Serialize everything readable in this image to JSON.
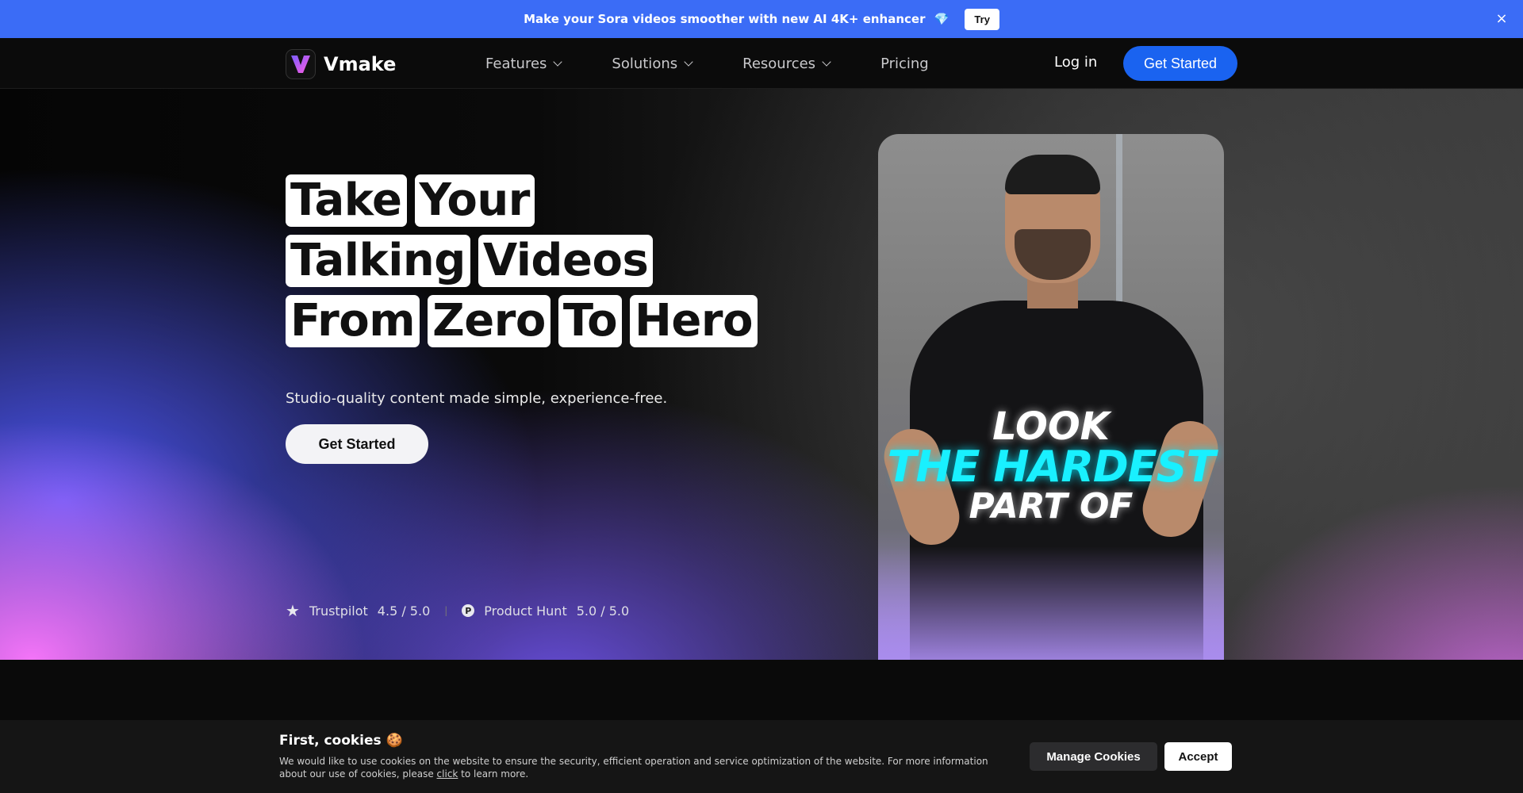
{
  "promo": {
    "text": "Make your Sora videos smoother with new AI 4K+ enhancer",
    "gem": "💎",
    "try_label": "Try",
    "close_icon": "×"
  },
  "nav": {
    "logo_text": "Vmake",
    "items": [
      {
        "label": "Features",
        "has_dropdown": true
      },
      {
        "label": "Solutions",
        "has_dropdown": true
      },
      {
        "label": "Resources",
        "has_dropdown": true
      },
      {
        "label": "Pricing",
        "has_dropdown": false
      }
    ],
    "login_label": "Log in",
    "cta_label": "Get Started"
  },
  "hero": {
    "headline_rows": [
      [
        "Take",
        "Your"
      ],
      [
        "Talking",
        "Videos"
      ],
      [
        "From",
        "Zero",
        "To",
        "Hero"
      ]
    ],
    "subheadline": "Studio-quality content made simple, experience-free.",
    "cta_label": "Get Started",
    "ratings": {
      "trustpilot_label": "Trustpilot",
      "trustpilot_score": "4.5 / 5.0",
      "producthunt_label": "Product Hunt",
      "producthunt_score": "5.0 / 5.0",
      "producthunt_icon_letter": "P",
      "separator": "|"
    }
  },
  "video": {
    "caption_line1": "LOOK",
    "caption_line2": "THE HARDEST",
    "caption_line3": "PART OF"
  },
  "cookie": {
    "title": "First, cookies 🍪",
    "text_before": "We would like to use cookies on the website to ensure the security, efficient operation and service optimization of the website. For more information about our use of cookies, please ",
    "link": "click",
    "text_after": " to learn more.",
    "manage_label": "Manage Cookies",
    "accept_label": "Accept"
  },
  "colors": {
    "promo_bg": "#3b6cf6",
    "cta_blue": "#1a63f0",
    "caption_cyan": "#19f0ff"
  }
}
